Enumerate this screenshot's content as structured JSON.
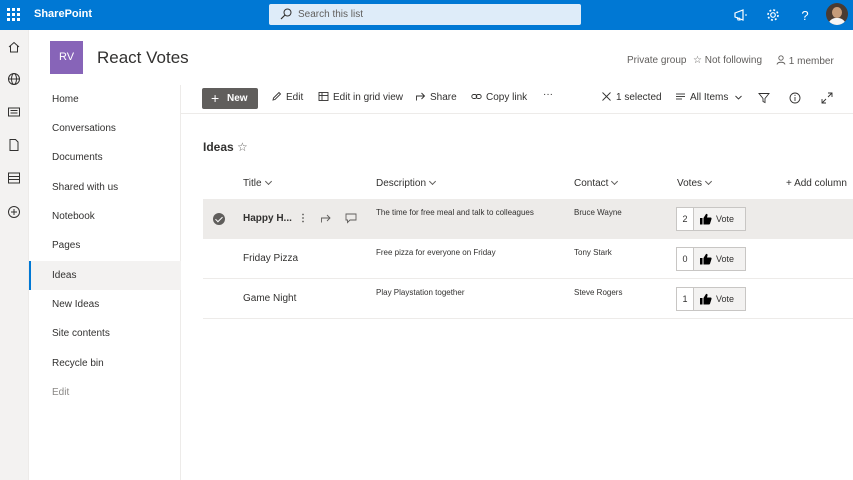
{
  "suite": {
    "brand": "SharePoint",
    "search_placeholder": "Search this list"
  },
  "site": {
    "logo_initials": "RV",
    "title": "React Votes",
    "privacy": "Private group",
    "follow_label": "Not following",
    "members_label": "1 member"
  },
  "nav": {
    "items": [
      {
        "label": "Home"
      },
      {
        "label": "Conversations"
      },
      {
        "label": "Documents"
      },
      {
        "label": "Shared with us"
      },
      {
        "label": "Notebook"
      },
      {
        "label": "Pages"
      },
      {
        "label": "Ideas"
      },
      {
        "label": "New Ideas"
      },
      {
        "label": "Site contents"
      },
      {
        "label": "Recycle bin"
      },
      {
        "label": "Edit"
      }
    ],
    "selected": "Ideas"
  },
  "commandbar": {
    "new_label": "New",
    "edit_label": "Edit",
    "grid_label": "Edit in grid view",
    "share_label": "Share",
    "copylink_label": "Copy link",
    "more_label": "···",
    "selected_label": "1 selected",
    "view_label": "All Items"
  },
  "list": {
    "title": "Ideas",
    "columns": {
      "title": "Title",
      "description": "Description",
      "contact": "Contact",
      "votes": "Votes",
      "add": "Add column"
    },
    "vote_button_label": "Vote",
    "rows": [
      {
        "title": "Happy H...",
        "description": "The time for free meal and talk to colleagues",
        "contact": "Bruce Wayne",
        "votes": "2",
        "selected": true
      },
      {
        "title": "Friday Pizza",
        "description": "Free pizza for everyone on Friday",
        "contact": "Tony Stark",
        "votes": "0",
        "selected": false
      },
      {
        "title": "Game Night",
        "description": "Play Playstation together",
        "contact": "Steve Rogers",
        "votes": "1",
        "selected": false
      }
    ]
  },
  "colors": {
    "suite_bar": "#0078d4",
    "site_logo": "#8764b8",
    "new_button": "#605e5c",
    "selected_row": "#edebe9"
  }
}
